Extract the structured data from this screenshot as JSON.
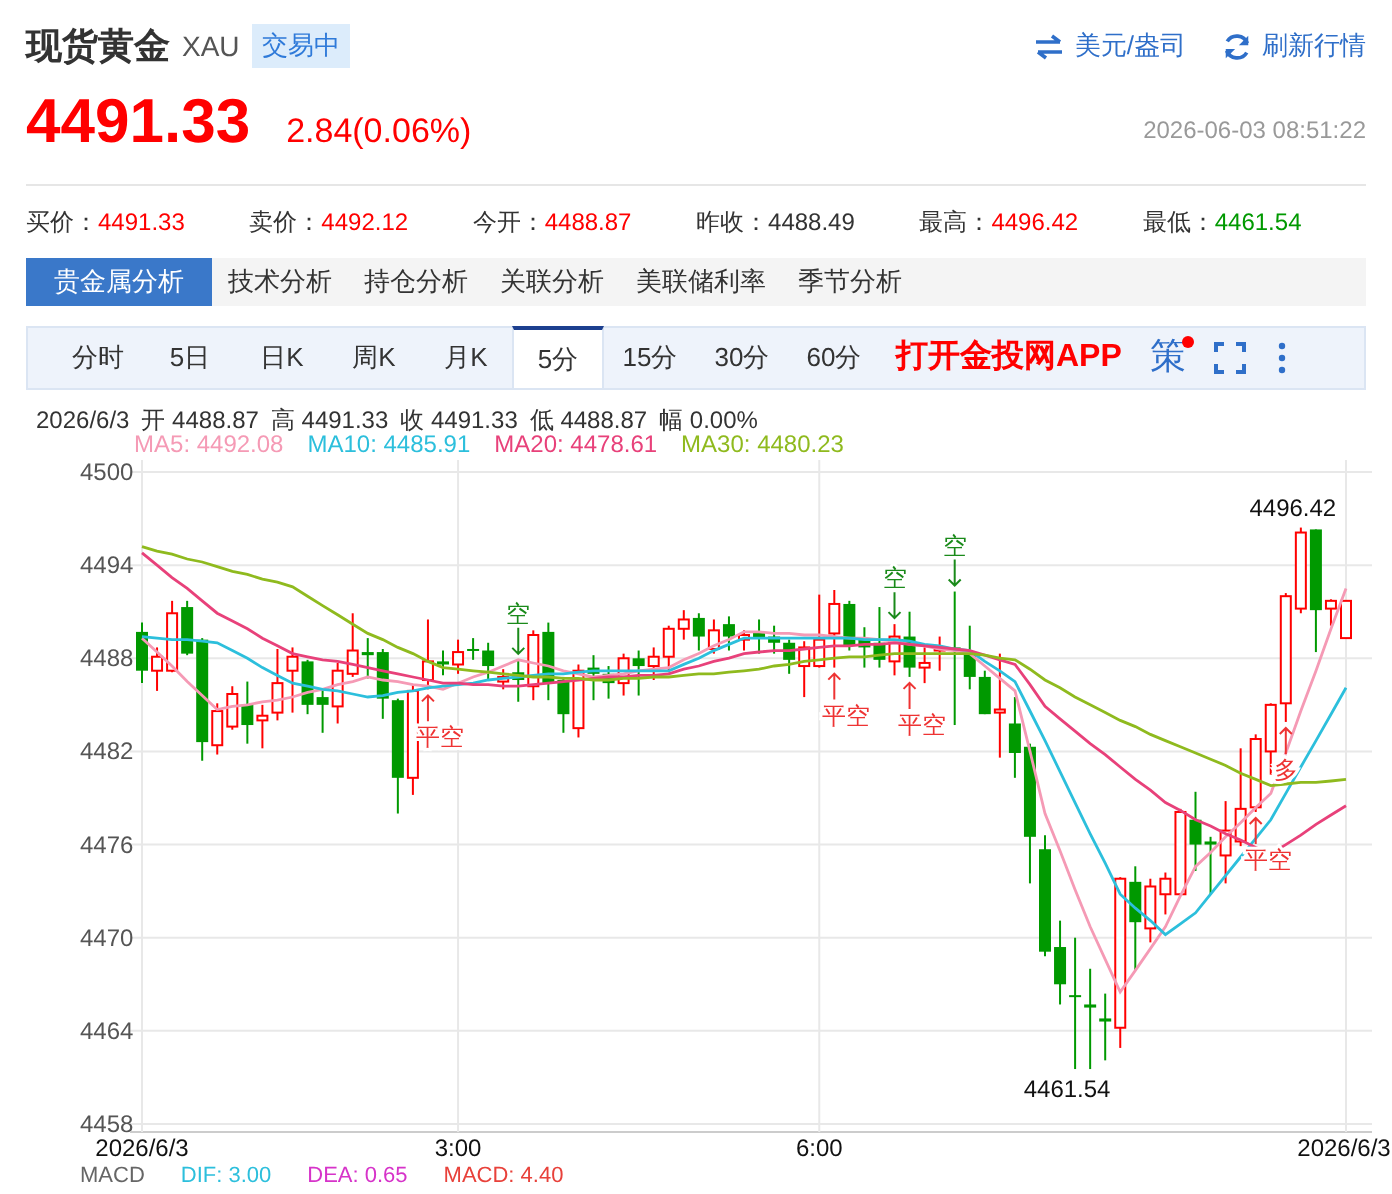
{
  "header": {
    "title": "现货黄金",
    "symbol": "XAU",
    "status": "交易中",
    "unit_button": "美元/盎司",
    "refresh_button": "刷新行情"
  },
  "quote": {
    "price": "4491.33",
    "change": "2.84(0.06%)",
    "time": "2026-06-03 08:51:22"
  },
  "stats": [
    {
      "label": "买价：",
      "value": "4491.33",
      "color": "#ff0000"
    },
    {
      "label": "卖价：",
      "value": "4492.12",
      "color": "#ff0000"
    },
    {
      "label": "今开：",
      "value": "4488.87",
      "color": "#ff0000"
    },
    {
      "label": "昨收：",
      "value": "4488.49",
      "color": "#333333"
    },
    {
      "label": "最高：",
      "value": "4496.42",
      "color": "#ff0000"
    },
    {
      "label": "最低：",
      "value": "4461.54",
      "color": "#009900"
    }
  ],
  "analysis_tabs": [
    {
      "label": "贵金属分析",
      "selected": true
    },
    {
      "label": "技术分析",
      "selected": false
    },
    {
      "label": "持仓分析",
      "selected": false
    },
    {
      "label": "关联分析",
      "selected": false
    },
    {
      "label": "美联储利率",
      "selected": false
    },
    {
      "label": "季节分析",
      "selected": false
    }
  ],
  "period_tabs": [
    {
      "label": "分时",
      "selected": false
    },
    {
      "label": "5日",
      "selected": false
    },
    {
      "label": "日K",
      "selected": false
    },
    {
      "label": "周K",
      "selected": false
    },
    {
      "label": "月K",
      "selected": false
    },
    {
      "label": "5分",
      "selected": true
    },
    {
      "label": "15分",
      "selected": false
    },
    {
      "label": "30分",
      "selected": false
    },
    {
      "label": "60分",
      "selected": false
    }
  ],
  "app_link": "打开金投网APP",
  "strategy_button": {
    "label": "策",
    "notification": true
  },
  "ohlc_summary": [
    "2026/6/3",
    "开 4488.87",
    "高 4491.33",
    "收 4491.33",
    "低 4488.87",
    "幅 0.00%"
  ],
  "chart": {
    "ma_readings": [
      ": 4492.08",
      ": 4485.91",
      ": 4478.61",
      ": 4480.23"
    ],
    "chart_data": {
      "type": "candlestick",
      "ylim": [
        4458,
        4500
      ],
      "yticks": [
        4458,
        4464,
        4470,
        4476,
        4482,
        4488,
        4494,
        4500
      ],
      "categories": [
        "2026/6/3",
        null,
        null,
        null,
        null,
        null,
        null,
        null,
        null,
        null,
        null,
        null,
        null,
        null,
        null,
        null,
        null,
        null,
        null,
        null,
        null,
        "3:00",
        null,
        null,
        null,
        null,
        null,
        null,
        null,
        null,
        null,
        null,
        null,
        null,
        null,
        null,
        null,
        null,
        null,
        null,
        null,
        null,
        null,
        null,
        null,
        "6:00",
        null,
        null,
        null,
        null,
        null,
        null,
        null,
        null,
        null,
        null,
        null,
        null,
        null,
        null,
        null,
        null,
        null,
        null,
        null,
        null,
        null,
        null,
        null,
        null,
        null,
        null,
        null,
        null,
        null,
        null,
        null,
        null,
        null,
        null,
        "2026/6/3"
      ],
      "ohlc": [
        [
          4489.7,
          4490.3,
          4486.4,
          4487.2
        ],
        [
          4487.2,
          4488.7,
          4485.9,
          4488.1
        ],
        [
          4487.2,
          4491.7,
          4487.1,
          4490.9
        ],
        [
          4491.3,
          4491.7,
          4488.2,
          4488.3
        ],
        [
          4489.2,
          4489.3,
          4481.4,
          4482.6
        ],
        [
          4482.4,
          4485.1,
          4481.8,
          4484.6
        ],
        [
          4483.6,
          4486.2,
          4483.4,
          4485.7
        ],
        [
          4485.0,
          4486.5,
          4482.5,
          4483.7
        ],
        [
          4484.0,
          4485.0,
          4482.2,
          4484.3
        ],
        [
          4484.5,
          4488.6,
          4484.0,
          4486.4
        ],
        [
          4487.2,
          4488.7,
          4484.5,
          4488.1
        ],
        [
          4487.8,
          4487.9,
          4484.4,
          4485.0
        ],
        [
          4485.5,
          4486.0,
          4483.2,
          4485.0
        ],
        [
          4484.9,
          4487.7,
          4483.8,
          4487.2
        ],
        [
          4487.0,
          4490.9,
          4486.8,
          4488.5
        ],
        [
          4488.4,
          4489.3,
          4486.7,
          4488.2
        ],
        [
          4488.4,
          4488.6,
          4484.1,
          4485.4
        ],
        [
          4485.3,
          4485.4,
          4478.0,
          4480.3
        ],
        [
          4480.3,
          4486.3,
          4479.2,
          4485.9
        ],
        [
          4486.6,
          4490.5,
          4486.0,
          4487.8
        ],
        [
          4487.8,
          4488.5,
          4486.9,
          4487.6
        ],
        [
          4487.6,
          4489.2,
          4487.0,
          4488.4
        ],
        [
          4488.6,
          4489.3,
          4487.9,
          4488.5
        ],
        [
          4488.5,
          4489.0,
          4486.6,
          4487.5
        ],
        [
          4486.5,
          4487.3,
          4486.0,
          4486.8
        ],
        [
          4487.1,
          4487.9,
          4485.2,
          4486.6
        ],
        [
          4486.2,
          4489.8,
          4485.3,
          4489.5
        ],
        [
          4489.7,
          4490.3,
          4485.3,
          4486.4
        ],
        [
          4486.6,
          4486.8,
          4483.2,
          4484.4
        ],
        [
          4483.5,
          4487.6,
          4482.9,
          4487.2
        ],
        [
          4487.4,
          4488.2,
          4485.3,
          4487.0
        ],
        [
          4487.0,
          4487.5,
          4485.4,
          4486.4
        ],
        [
          4486.4,
          4488.3,
          4485.6,
          4488.0
        ],
        [
          4488.0,
          4488.5,
          4485.6,
          4487.5
        ],
        [
          4487.5,
          4488.7,
          4486.6,
          4488.1
        ],
        [
          4488.1,
          4490.1,
          4487.1,
          4489.9
        ],
        [
          4489.9,
          4491.1,
          4489.2,
          4490.5
        ],
        [
          4490.6,
          4490.9,
          4488.5,
          4489.4
        ],
        [
          4488.6,
          4490.5,
          4488.3,
          4489.8
        ],
        [
          4490.2,
          4490.7,
          4488.5,
          4489.4
        ],
        [
          4489.2,
          4489.8,
          4488.5,
          4489.5
        ],
        [
          4489.7,
          4490.5,
          4488.3,
          4489.3
        ],
        [
          4489.4,
          4490.1,
          4488.3,
          4489.0
        ],
        [
          4489.0,
          4489.2,
          4487.0,
          4487.9
        ],
        [
          4487.5,
          4489.1,
          4485.5,
          4488.7
        ],
        [
          4487.5,
          4492.1,
          4487.4,
          4489.2
        ],
        [
          4489.6,
          4492.4,
          4487.4,
          4491.5
        ],
        [
          4491.5,
          4491.7,
          4488.5,
          4488.8
        ],
        [
          4489.2,
          4490.0,
          4487.4,
          4488.7
        ],
        [
          4489.0,
          4491.3,
          4487.4,
          4487.9
        ],
        [
          4487.8,
          4490.2,
          4486.9,
          4489.4
        ],
        [
          4489.4,
          4491.0,
          4486.8,
          4487.4
        ],
        [
          4487.4,
          4488.7,
          4486.4,
          4487.7
        ],
        [
          4488.5,
          4489.4,
          4487.2,
          4488.7
        ],
        [
          4488.7,
          4492.3,
          4483.7,
          4488.5
        ],
        [
          4488.3,
          4490.1,
          4486.0,
          4486.8
        ],
        [
          4486.8,
          4487.2,
          4484.4,
          4484.4
        ],
        [
          4484.5,
          4488.3,
          4481.6,
          4484.7
        ],
        [
          4483.8,
          4485.5,
          4480.3,
          4481.9
        ],
        [
          4482.3,
          4482.5,
          4473.5,
          4476.5
        ],
        [
          4475.7,
          4476.6,
          4468.8,
          4469.1
        ],
        [
          4469.4,
          4471.1,
          4465.7,
          4467.0
        ],
        [
          4466.3,
          4470.0,
          4461.54,
          4466.2
        ],
        [
          4465.7,
          4468.0,
          4461.54,
          4465.5
        ],
        [
          4464.8,
          4466.4,
          4462.1,
          4464.6
        ],
        [
          4464.2,
          4473.9,
          4462.9,
          4473.8
        ],
        [
          4473.6,
          4474.6,
          4467.9,
          4471.0
        ],
        [
          4470.6,
          4473.8,
          4469.7,
          4473.3
        ],
        [
          4472.8,
          4474.2,
          4471.5,
          4473.8
        ],
        [
          4472.8,
          4478.3,
          4472.7,
          4478.1
        ],
        [
          4477.6,
          4479.4,
          4474.3,
          4476.0
        ],
        [
          4476.2,
          4476.5,
          4472.8,
          4476.0
        ],
        [
          4475.3,
          4478.8,
          4473.5,
          4476.9
        ],
        [
          4476.2,
          4482.2,
          4475.9,
          4478.3
        ],
        [
          4478.4,
          4483.1,
          4478.1,
          4482.8
        ],
        [
          4482.0,
          4485.1,
          4480.5,
          4485.0
        ],
        [
          4485.1,
          4492.2,
          4483.9,
          4492.0
        ],
        [
          4491.2,
          4496.42,
          4490.9,
          4496.1
        ],
        [
          4496.3,
          4496.3,
          4488.4,
          4491.1
        ],
        [
          4491.2,
          4491.8,
          4490.1,
          4491.7
        ],
        [
          4489.3,
          4491.7,
          4489.3,
          4491.7
        ]
      ],
      "series": [
        {
          "name": "MA5",
          "type": "line",
          "color": "#f59ab5",
          "values": [
            4489.3,
            4488.4,
            4487.5,
            4486.5,
            4485.6,
            4484.7,
            4484.9,
            4485.0,
            4485.2,
            4485.3,
            4485.5,
            4485.8,
            4486.0,
            4486.3,
            4486.5,
            4486.8,
            4486.6,
            4486.5,
            4486.3,
            4486.2,
            4486.0,
            4486.4,
            4486.8,
            4487.1,
            4487.5,
            4487.9,
            4487.7,
            4487.5,
            4487.2,
            4487.0,
            4486.8,
            4486.9,
            4487.0,
            4487.2,
            4487.3,
            4487.4,
            4487.9,
            4488.3,
            4488.8,
            4489.2,
            4489.7,
            4489.7,
            4489.6,
            4489.6,
            4489.5,
            4489.5,
            4489.4,
            4489.3,
            4489.3,
            4489.2,
            4489.1,
            4488.9,
            4488.8,
            4488.6,
            4488.5,
            4488.3,
            4487.5,
            4486.7,
            4485.9,
            4482.0,
            4478.0,
            4475.6,
            4473.1,
            4470.7,
            4468.6,
            4466.5,
            4467.9,
            4469.3,
            4470.7,
            4472.7,
            4474.6,
            4475.5,
            4476.5,
            4477.4,
            4478.4,
            4479.3,
            4481.9,
            4484.6,
            4487.2,
            4489.9,
            4492.5
          ]
        },
        {
          "name": "MA10",
          "type": "line",
          "color": "#2cbfdc",
          "values": [
            4489.4,
            4489.3,
            4489.2,
            4489.2,
            4489.1,
            4489.0,
            4488.5,
            4488.0,
            4487.4,
            4486.9,
            4486.4,
            4486.2,
            4486.0,
            4485.9,
            4485.7,
            4485.5,
            4485.6,
            4485.8,
            4485.9,
            4486.1,
            4486.2,
            4486.3,
            4486.4,
            4486.6,
            4486.7,
            4486.8,
            4486.9,
            4487.0,
            4487.0,
            4487.1,
            4487.2,
            4487.2,
            4487.2,
            4487.2,
            4487.2,
            4487.2,
            4487.6,
            4488.0,
            4488.5,
            4488.9,
            4489.3,
            4489.3,
            4489.3,
            4489.3,
            4489.3,
            4489.3,
            4489.3,
            4489.3,
            4489.2,
            4489.2,
            4489.2,
            4489.1,
            4488.9,
            4488.8,
            4488.6,
            4488.5,
            4487.8,
            4487.2,
            4486.5,
            4484.6,
            4482.7,
            4480.7,
            4478.7,
            4476.7,
            4474.8,
            4472.8,
            4471.9,
            4471.1,
            4470.2,
            4470.9,
            4471.6,
            4472.8,
            4474.0,
            4475.2,
            4476.4,
            4477.6,
            4479.3,
            4481.0,
            4482.7,
            4484.4,
            4486.1
          ]
        },
        {
          "name": "MA20",
          "type": "line",
          "color": "#e8417a",
          "values": [
            4494.8,
            4494.0,
            4493.2,
            4492.5,
            4491.7,
            4490.9,
            4490.4,
            4489.9,
            4489.3,
            4488.8,
            4488.3,
            4488.1,
            4487.9,
            4487.8,
            4487.6,
            4487.4,
            4487.2,
            4487.0,
            4486.8,
            4486.6,
            4486.4,
            4486.4,
            4486.3,
            4486.3,
            4486.2,
            4486.2,
            4486.3,
            4486.4,
            4486.5,
            4486.6,
            4486.7,
            4486.8,
            4486.8,
            4486.9,
            4486.9,
            4487.0,
            4487.3,
            4487.5,
            4487.8,
            4488.0,
            4488.3,
            4488.4,
            4488.5,
            4488.5,
            4488.6,
            4488.7,
            4488.8,
            4488.8,
            4488.9,
            4488.9,
            4489.0,
            4488.9,
            4488.8,
            4488.7,
            4488.6,
            4488.5,
            4488.2,
            4487.9,
            4487.6,
            4486.3,
            4484.9,
            4484.1,
            4483.3,
            4482.5,
            4481.8,
            4481.0,
            4480.2,
            4479.5,
            4478.7,
            4478.2,
            4477.6,
            4477.2,
            4476.7,
            4476.3,
            4475.8,
            4475.4,
            4476.0,
            4476.6,
            4477.3,
            4477.9,
            4478.5
          ]
        },
        {
          "name": "MA30",
          "type": "line",
          "color": "#8fba1e",
          "values": [
            4495.2,
            4494.9,
            4494.7,
            4494.4,
            4494.2,
            4493.9,
            4493.6,
            4493.4,
            4493.1,
            4492.9,
            4492.6,
            4492.0,
            4491.4,
            4490.8,
            4490.2,
            4489.6,
            4489.2,
            4488.7,
            4488.3,
            4487.8,
            4487.4,
            4487.3,
            4487.2,
            4487.1,
            4487.0,
            4486.9,
            4486.8,
            4486.8,
            4486.7,
            4486.7,
            4486.6,
            4486.6,
            4486.7,
            4486.7,
            4486.8,
            4486.8,
            4486.9,
            4487.0,
            4487.0,
            4487.1,
            4487.2,
            4487.3,
            4487.5,
            4487.6,
            4487.8,
            4487.9,
            4488.0,
            4488.1,
            4488.1,
            4488.2,
            4488.3,
            4488.3,
            4488.3,
            4488.3,
            4488.3,
            4488.3,
            4488.2,
            4488.0,
            4487.9,
            4487.3,
            4486.6,
            4486.1,
            4485.5,
            4485.0,
            4484.5,
            4484.0,
            4483.6,
            4483.1,
            4482.7,
            4482.3,
            4481.9,
            4481.5,
            4481.1,
            4480.6,
            4480.2,
            4479.8,
            4479.9,
            4480.0,
            4480.0,
            4480.1,
            4480.2
          ]
        }
      ],
      "grid": true,
      "annotations": [
        {
          "text": "4496.42"
        },
        {
          "text": "4461.54"
        }
      ]
    },
    "signals_by_candle": [
      {
        "kind": "none"
      },
      {
        "kind": "none"
      },
      {
        "kind": "none"
      },
      {
        "kind": "none"
      },
      {
        "kind": "none"
      },
      {
        "kind": "none"
      },
      {
        "kind": "none"
      },
      {
        "kind": "none"
      },
      {
        "kind": "none"
      },
      {
        "kind": "none"
      },
      {
        "kind": "none"
      },
      {
        "kind": "none"
      },
      {
        "kind": "none"
      },
      {
        "kind": "none"
      },
      {
        "kind": "none"
      },
      {
        "kind": "none"
      },
      {
        "kind": "none"
      },
      {
        "kind": "none"
      },
      {
        "kind": "none"
      },
      {
        "kind": "cover",
        "label": "平空"
      },
      {
        "kind": "none"
      },
      {
        "kind": "none"
      },
      {
        "kind": "none"
      },
      {
        "kind": "none"
      },
      {
        "kind": "none"
      },
      {
        "kind": "short",
        "label": "空"
      },
      {
        "kind": "none"
      },
      {
        "kind": "none"
      },
      {
        "kind": "none"
      },
      {
        "kind": "none"
      },
      {
        "kind": "none"
      },
      {
        "kind": "none"
      },
      {
        "kind": "none"
      },
      {
        "kind": "none"
      },
      {
        "kind": "none"
      },
      {
        "kind": "none"
      },
      {
        "kind": "none"
      },
      {
        "kind": "none"
      },
      {
        "kind": "none"
      },
      {
        "kind": "none"
      },
      {
        "kind": "none"
      },
      {
        "kind": "none"
      },
      {
        "kind": "none"
      },
      {
        "kind": "none"
      },
      {
        "kind": "none"
      },
      {
        "kind": "none"
      },
      {
        "kind": "cover",
        "label": "平空"
      },
      {
        "kind": "none"
      },
      {
        "kind": "none"
      },
      {
        "kind": "none"
      },
      {
        "kind": "short",
        "label": "空"
      },
      {
        "kind": "cover",
        "label": "平空"
      },
      {
        "kind": "none"
      },
      {
        "kind": "none"
      },
      {
        "kind": "short",
        "label": "空"
      },
      {
        "kind": "none"
      },
      {
        "kind": "none"
      },
      {
        "kind": "none"
      },
      {
        "kind": "none"
      },
      {
        "kind": "none"
      },
      {
        "kind": "none"
      },
      {
        "kind": "none"
      },
      {
        "kind": "none"
      },
      {
        "kind": "none"
      },
      {
        "kind": "none"
      },
      {
        "kind": "none"
      },
      {
        "kind": "none"
      },
      {
        "kind": "none"
      },
      {
        "kind": "none"
      },
      {
        "kind": "none"
      },
      {
        "kind": "none"
      },
      {
        "kind": "none"
      },
      {
        "kind": "none"
      },
      {
        "kind": "none"
      },
      {
        "kind": "cover",
        "label": "平空"
      },
      {
        "kind": "none"
      },
      {
        "kind": "long",
        "label": "多"
      },
      {
        "kind": "none"
      },
      {
        "kind": "none"
      },
      {
        "kind": "none"
      },
      {
        "kind": "none"
      }
    ]
  },
  "macd_legend": [
    {
      "text": "MACD",
      "color": "#666666"
    },
    {
      "text": "DIF: 3.00",
      "color": "#2cbfdc"
    },
    {
      "text": "DEA: 0.65",
      "color": "#d633c9"
    },
    {
      "text": "MACD: 4.40",
      "color": "#e8413a"
    }
  ]
}
